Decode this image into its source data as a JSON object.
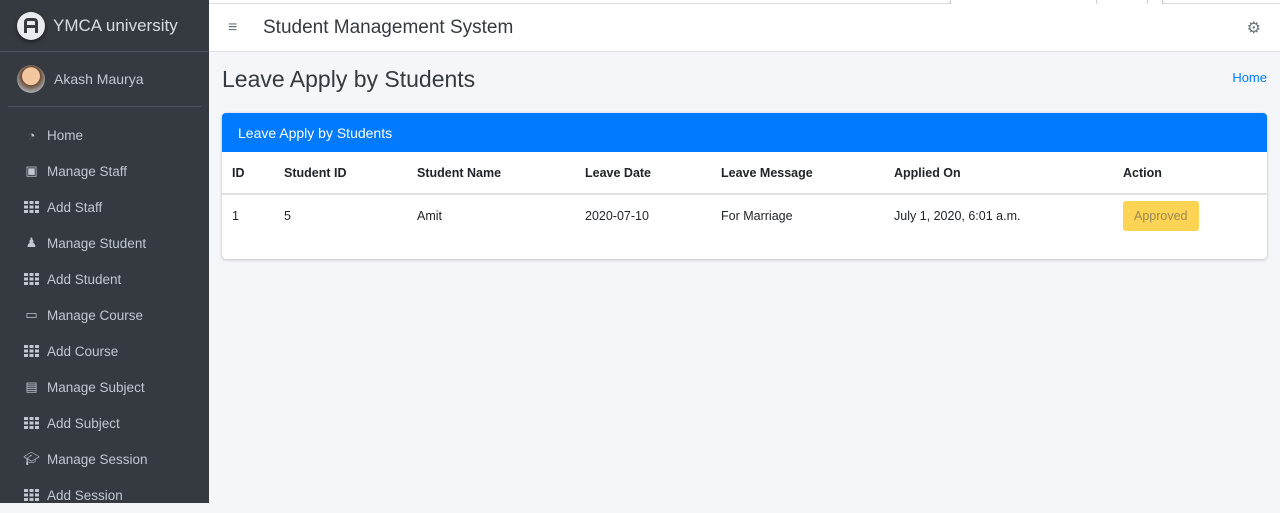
{
  "sidebar": {
    "brand": "YMCA university",
    "user": "Akash Maurya",
    "items": [
      {
        "label": "Home",
        "icon": "dashboard-icon"
      },
      {
        "label": "Manage Staff",
        "icon": "staff-icon"
      },
      {
        "label": "Add Staff",
        "icon": "grid-icon"
      },
      {
        "label": "Manage Student",
        "icon": "student-icon"
      },
      {
        "label": "Add Student",
        "icon": "grid-icon"
      },
      {
        "label": "Manage Course",
        "icon": "laptop-icon"
      },
      {
        "label": "Add Course",
        "icon": "grid-icon"
      },
      {
        "label": "Manage Subject",
        "icon": "book-icon"
      },
      {
        "label": "Add Subject",
        "icon": "grid-icon"
      },
      {
        "label": "Manage Session",
        "icon": "graduation-cap-icon"
      },
      {
        "label": "Add Session",
        "icon": "grid-icon"
      }
    ]
  },
  "topbar": {
    "title": "Student Management System"
  },
  "page": {
    "title": "Leave Apply by Students",
    "breadcrumb": "Home"
  },
  "card": {
    "title": "Leave Apply by Students",
    "columns": [
      "ID",
      "Student ID",
      "Student Name",
      "Leave Date",
      "Leave Message",
      "Applied On",
      "Action"
    ],
    "rows": [
      {
        "id": "1",
        "student_id": "5",
        "name": "Amit",
        "date": "2020-07-10",
        "message": "For Marriage",
        "applied": "July 1, 2020, 6:01 a.m.",
        "action": "Approved"
      }
    ]
  },
  "colors": {
    "primary": "#007bff",
    "sidebar": "#343a40",
    "warning": "#ffc107"
  }
}
